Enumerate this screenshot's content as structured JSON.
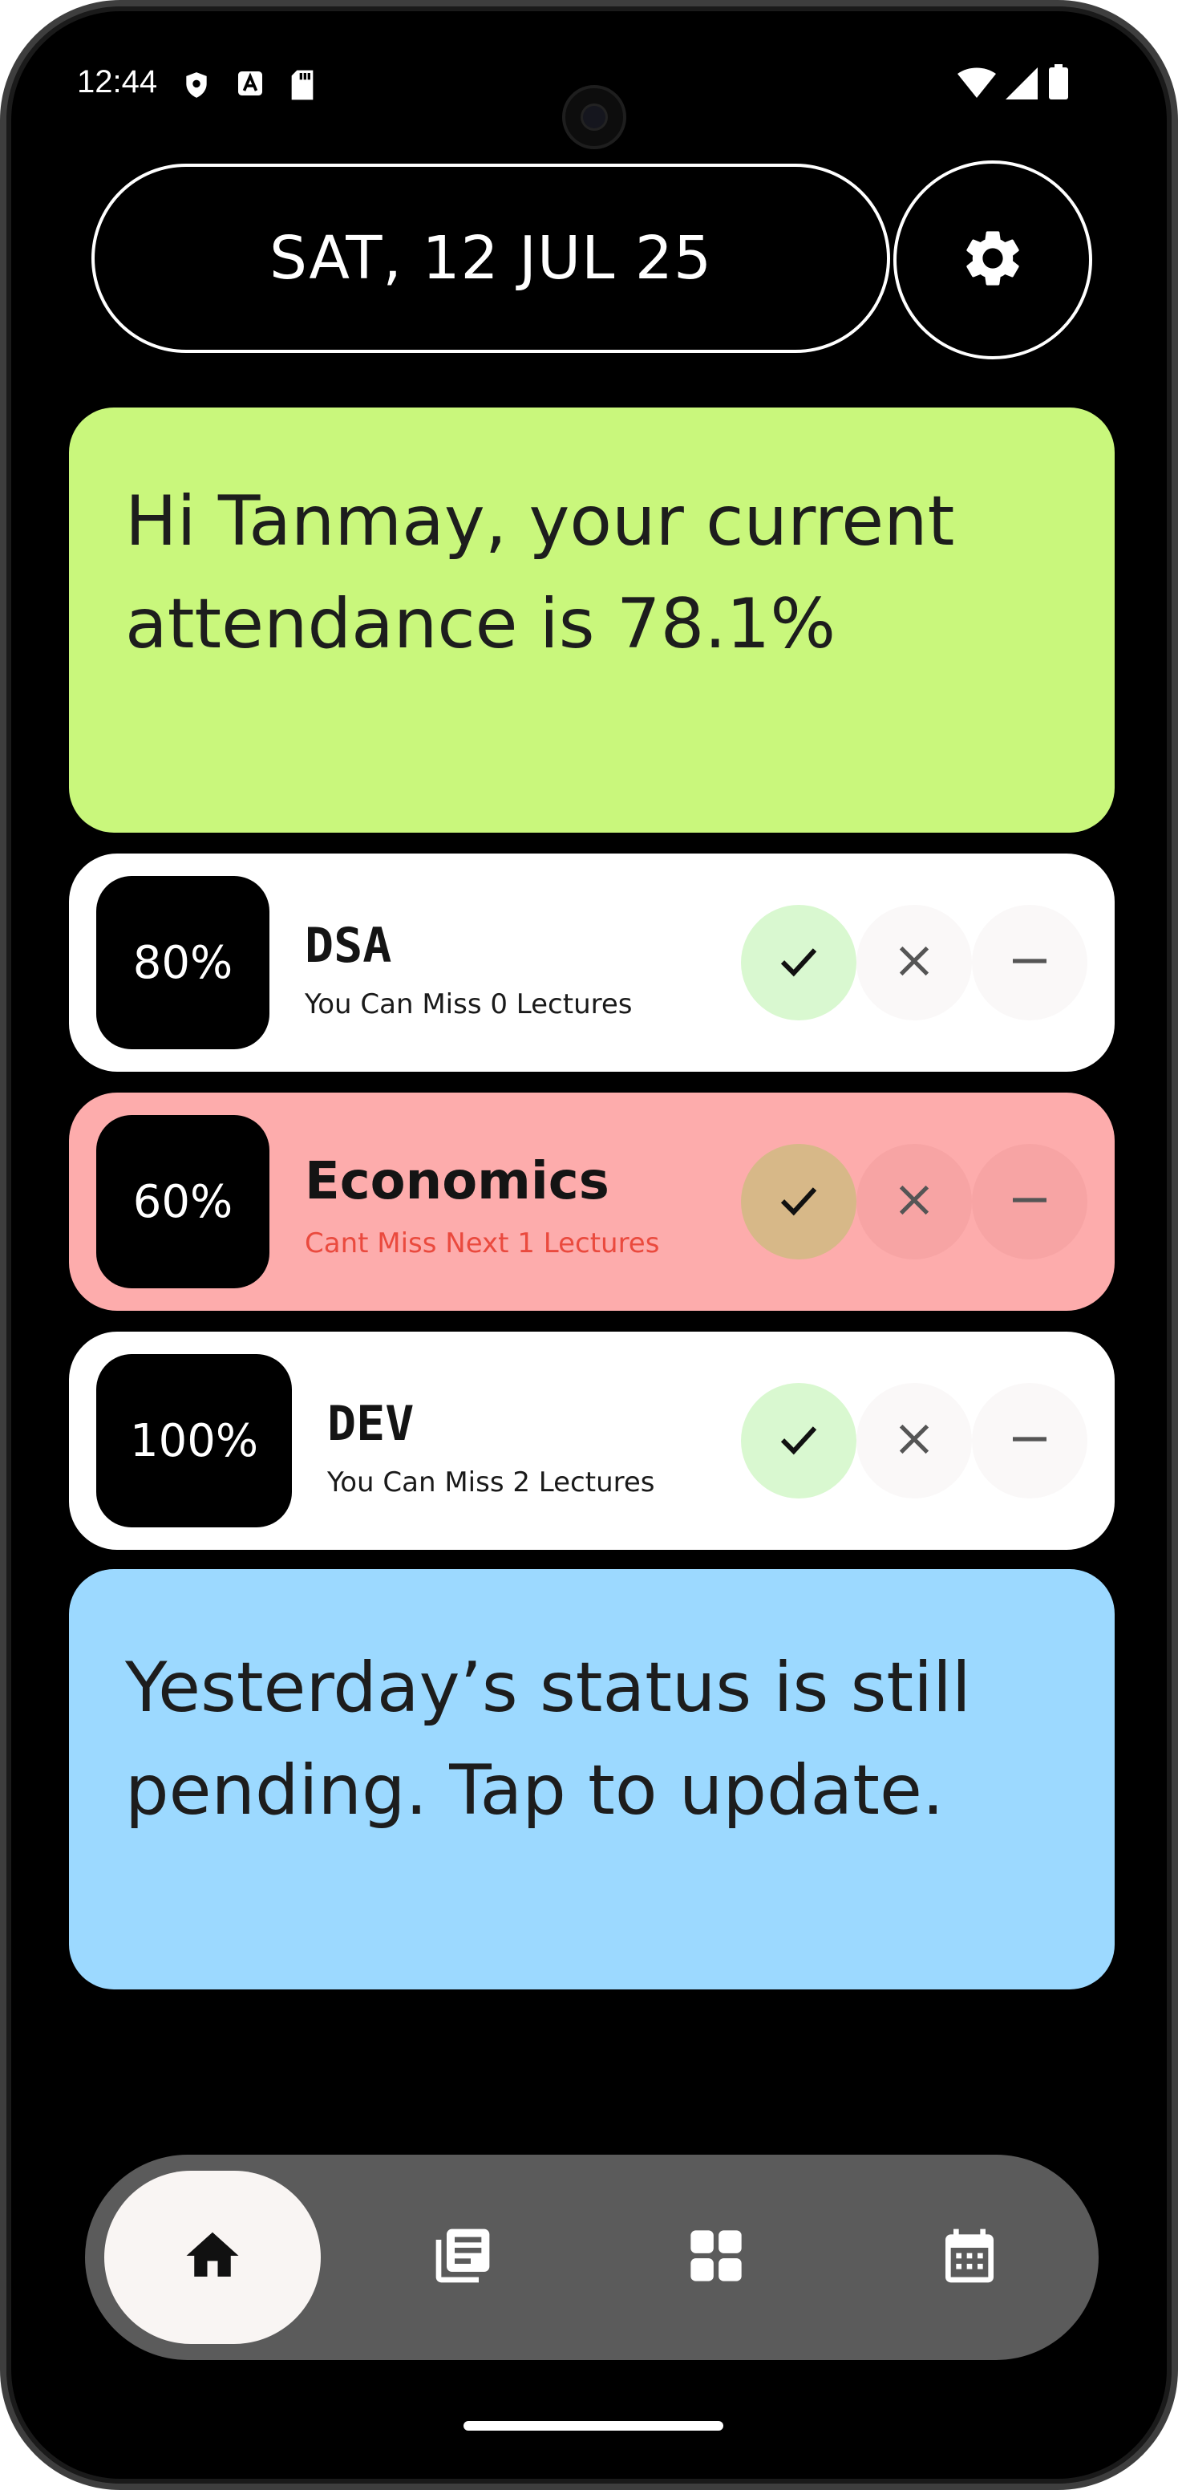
{
  "status_bar": {
    "time": "12:44",
    "left_icons": [
      "shield-icon",
      "font-icon",
      "sd-card-icon"
    ],
    "right_icons": [
      "wifi-icon",
      "cellular-signal-icon",
      "battery-icon"
    ]
  },
  "header": {
    "date": "SAT, 12 JUL 25",
    "settings_icon": "gear-icon"
  },
  "greeting": {
    "text": "Hi Tanmay, your current attendance is 78.1%"
  },
  "subjects": [
    {
      "percent": "80%",
      "name": "DSA",
      "status": "You Can Miss 0 Lectures",
      "card_color": "#ffffff",
      "status_color": "#1a1a1a",
      "present_bg": "#d9f8d0"
    },
    {
      "percent": "60%",
      "name": "Economics",
      "status": "Cant Miss Next 1 Lectures",
      "card_color": "#fdacac",
      "status_color": "#ea4a3e",
      "present_bg": "#d7b888"
    },
    {
      "percent": "100%",
      "name": "DEV",
      "status": "You Can Miss 2 Lectures",
      "card_color": "#ffffff",
      "status_color": "#1a1a1a",
      "present_bg": "#d9f8d0"
    }
  ],
  "action_icons": [
    "check-icon",
    "close-icon",
    "minus-icon"
  ],
  "pending": {
    "text": "Yesterday’s status is still pending. Tap to update."
  },
  "nav": {
    "items": [
      {
        "icon": "home-icon",
        "active": true
      },
      {
        "icon": "library-icon",
        "active": false
      },
      {
        "icon": "grid-icon",
        "active": false
      },
      {
        "icon": "calendar-icon",
        "active": false
      }
    ]
  },
  "colors": {
    "greeting_bg": "#c9f77c",
    "pending_bg": "#9cd9ff",
    "nav_bg": "#5b5b5b",
    "nav_active_bg": "#f9f5f3"
  }
}
